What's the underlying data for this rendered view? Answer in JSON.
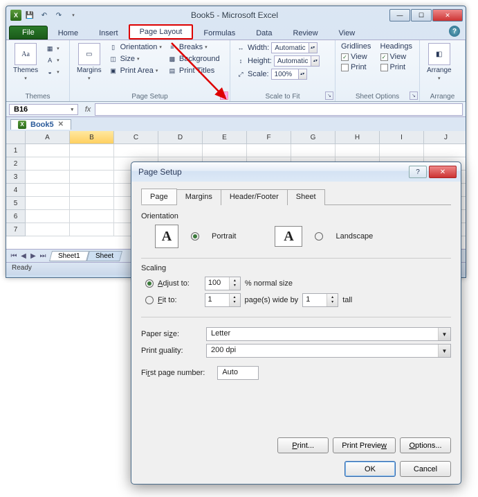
{
  "window": {
    "title": "Book5 - Microsoft Excel",
    "app_icon_letter": "X",
    "controls": {
      "min": "—",
      "max": "☐",
      "close": "✕"
    }
  },
  "tabs": {
    "file": "File",
    "items": [
      "Home",
      "Insert",
      "Page Layout",
      "Formulas",
      "Data",
      "Review",
      "View"
    ],
    "highlighted": "Page Layout",
    "help": "?"
  },
  "ribbon": {
    "themes": {
      "label": "Themes",
      "big": "Themes",
      "colors": "▾",
      "fonts": "A",
      "effects": "◒"
    },
    "page_setup": {
      "label": "Page Setup",
      "margins": "Margins",
      "orientation": "Orientation",
      "size": "Size",
      "print_area": "Print Area",
      "breaks": "Breaks",
      "background": "Background",
      "print_titles": "Print Titles"
    },
    "scale": {
      "label": "Scale to Fit",
      "width_lbl": "Width:",
      "width_val": "Automatic",
      "height_lbl": "Height:",
      "height_val": "Automatic",
      "scale_lbl": "Scale:",
      "scale_val": "100%"
    },
    "sheet_options": {
      "label": "Sheet Options",
      "gridlines": "Gridlines",
      "headings": "Headings",
      "view": "View",
      "print": "Print",
      "grid_view_checked": true,
      "head_view_checked": true
    },
    "arrange": {
      "label": "Arrange",
      "btn": "Arrange"
    }
  },
  "formula_bar": {
    "name_box": "B16",
    "fx": "fx"
  },
  "workbook_tab": {
    "name": "Book5",
    "x": "✕"
  },
  "grid": {
    "cols": [
      "A",
      "B",
      "C",
      "D",
      "E",
      "F",
      "G",
      "H",
      "I",
      "J"
    ],
    "rows": [
      "1",
      "2",
      "3",
      "4",
      "5",
      "6",
      "7"
    ],
    "selected_col": "B"
  },
  "sheets": {
    "active": "Sheet1",
    "next": "Sheet"
  },
  "status": "Ready",
  "dialog": {
    "title": "Page Setup",
    "help": "?",
    "close": "✕",
    "tabs": [
      "Page",
      "Margins",
      "Header/Footer",
      "Sheet"
    ],
    "active_tab": "Page",
    "orientation": {
      "label": "Orientation",
      "portrait": "Portrait",
      "landscape": "Landscape",
      "selected": "Portrait"
    },
    "scaling": {
      "label": "Scaling",
      "adjust_to": "Adjust to:",
      "adjust_val": "100",
      "adjust_suffix": "% normal size",
      "fit_to": "Fit to:",
      "fit_wide": "1",
      "fit_mid": "page(s) wide by",
      "fit_tall_v": "1",
      "fit_tall": "tall",
      "selected": "adjust"
    },
    "paper_size": {
      "label": "Paper size:",
      "value": "Letter"
    },
    "print_quality": {
      "label": "Print quality:",
      "value": "200 dpi"
    },
    "first_page": {
      "label": "First page number:",
      "value": "Auto"
    },
    "buttons": {
      "print": "Print...",
      "preview": "Print Preview",
      "options": "Options..."
    },
    "footer": {
      "ok": "OK",
      "cancel": "Cancel"
    }
  }
}
